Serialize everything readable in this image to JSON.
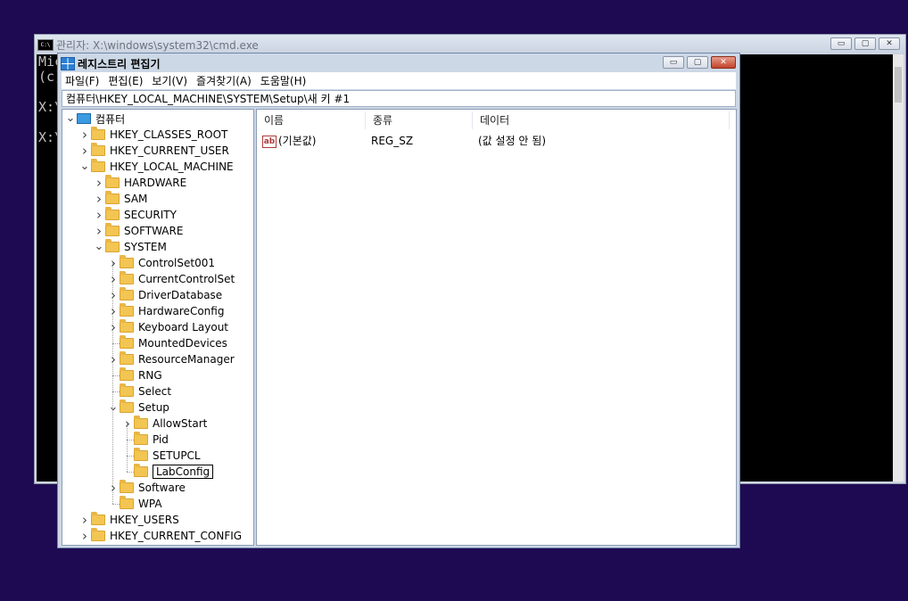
{
  "cmd": {
    "title": "관리자: X:\\windows\\system32\\cmd.exe",
    "icon_text": "C:\\",
    "lines": [
      "Mic",
      "(c)",
      "",
      "X:\\",
      "",
      "X:\\"
    ],
    "min_glyph": "▭",
    "max_glyph": "▢",
    "close_glyph": "✕"
  },
  "regedit": {
    "title": "레지스트리 편집기",
    "min_glyph": "▭",
    "max_glyph": "▢",
    "close_glyph": "✕",
    "menu": [
      "파일(F)",
      "편집(E)",
      "보기(V)",
      "즐겨찾기(A)",
      "도움말(H)"
    ],
    "address": "컴퓨터\\HKEY_LOCAL_MACHINE\\SYSTEM\\Setup\\새 키 #1",
    "tree": [
      {
        "label": "컴퓨터",
        "level": 0,
        "exp": "v",
        "icon": "monitor"
      },
      {
        "label": "HKEY_CLASSES_ROOT",
        "level": 1,
        "exp": ">"
      },
      {
        "label": "HKEY_CURRENT_USER",
        "level": 1,
        "exp": ">"
      },
      {
        "label": "HKEY_LOCAL_MACHINE",
        "level": 1,
        "exp": "v"
      },
      {
        "label": "HARDWARE",
        "level": 2,
        "exp": ">"
      },
      {
        "label": "SAM",
        "level": 2,
        "exp": ">"
      },
      {
        "label": "SECURITY",
        "level": 2,
        "exp": ">"
      },
      {
        "label": "SOFTWARE",
        "level": 2,
        "exp": ">"
      },
      {
        "label": "SYSTEM",
        "level": 2,
        "exp": "v"
      },
      {
        "label": "ControlSet001",
        "level": 3,
        "exp": ">"
      },
      {
        "label": "CurrentControlSet",
        "level": 3,
        "exp": ">"
      },
      {
        "label": "DriverDatabase",
        "level": 3,
        "exp": ">"
      },
      {
        "label": "HardwareConfig",
        "level": 3,
        "exp": ">"
      },
      {
        "label": "Keyboard Layout",
        "level": 3,
        "exp": ">"
      },
      {
        "label": "MountedDevices",
        "level": 3,
        "exp": ""
      },
      {
        "label": "ResourceManager",
        "level": 3,
        "exp": ">"
      },
      {
        "label": "RNG",
        "level": 3,
        "exp": ""
      },
      {
        "label": "Select",
        "level": 3,
        "exp": ""
      },
      {
        "label": "Setup",
        "level": 3,
        "exp": "v"
      },
      {
        "label": "AllowStart",
        "level": 4,
        "exp": ">"
      },
      {
        "label": "Pid",
        "level": 4,
        "exp": ""
      },
      {
        "label": "SETUPCL",
        "level": 4,
        "exp": ""
      },
      {
        "label": "LabConfig",
        "level": 4,
        "exp": "",
        "editing": true
      },
      {
        "label": "Software",
        "level": 3,
        "exp": ">"
      },
      {
        "label": "WPA",
        "level": 3,
        "exp": ""
      },
      {
        "label": "HKEY_USERS",
        "level": 1,
        "exp": ">"
      },
      {
        "label": "HKEY_CURRENT_CONFIG",
        "level": 1,
        "exp": ">"
      }
    ],
    "columns": [
      "이름",
      "종류",
      "데이터"
    ],
    "rows": [
      {
        "icon_text": "ab",
        "name": "(기본값)",
        "type": "REG_SZ",
        "data": "(값 설정 안 됨)"
      }
    ]
  }
}
